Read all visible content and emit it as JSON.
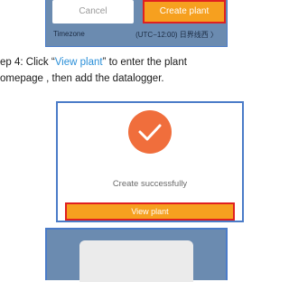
{
  "top_screen": {
    "cancel_label": "Cancel",
    "create_label": "Create plant",
    "timezone_label": "Timezone",
    "timezone_value": "(UTC−12:00) 日界线西 〉"
  },
  "instruction": {
    "prefix": "ep 4: Click “",
    "link": "View plant",
    "suffix": "” to enter the plant",
    "line2": "omepage , then add the datalogger."
  },
  "middle_screen": {
    "status_text": "Create successfully",
    "view_label": "View plant"
  },
  "colors": {
    "accent_orange": "#f6a01f",
    "highlight_red": "#e02020",
    "frame_blue": "#4a7bc8",
    "link_blue": "#2a8fd8",
    "check_orange": "#f06e3c"
  }
}
